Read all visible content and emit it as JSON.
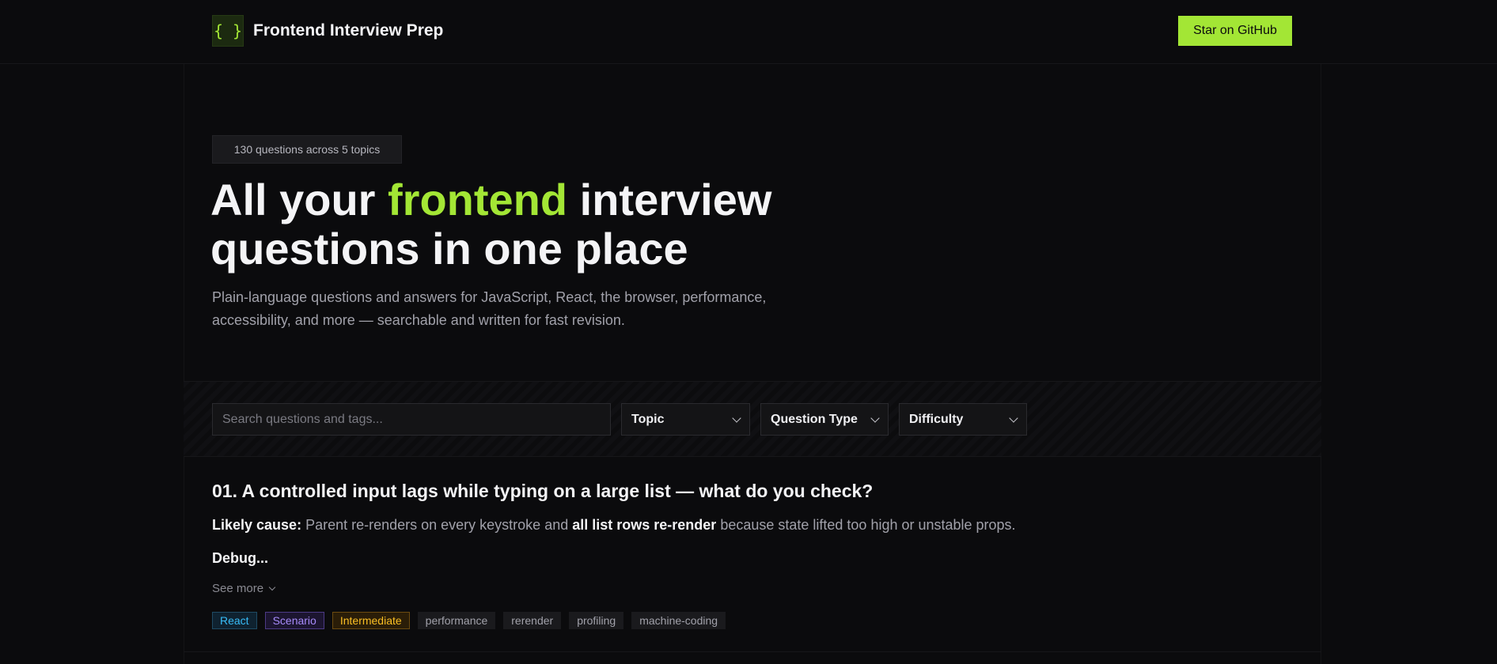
{
  "header": {
    "logo_glyph": "{ }",
    "brand": "Frontend Interview Prep",
    "github_button": "Star on GitHub"
  },
  "hero": {
    "badge": "130 questions across 5 topics",
    "headline_part1": "All your ",
    "headline_accent": "frontend",
    "headline_part2": " interview",
    "headline_line2": "questions in one place",
    "subtitle": "Plain-language questions and answers for JavaScript, React, the browser, performance, accessibility, and more — searchable and written for fast revision."
  },
  "filters": {
    "search_placeholder": "Search questions and tags...",
    "search_value": "",
    "topic": "Topic",
    "question_type": "Question Type",
    "difficulty": "Difficulty"
  },
  "question": {
    "title": "01. A controlled input lags while typing on a large list — what do you check?",
    "likely_label": "Likely cause:",
    "answer_part1": " Parent re-renders on every keystroke and ",
    "answer_bold": "all list rows re-render",
    "answer_part2": " because state lifted too high or unstable props.",
    "debug": "Debug...",
    "see_more": "See more",
    "tags": {
      "topic": "React",
      "type": "Scenario",
      "difficulty": "Intermediate",
      "t1": "performance",
      "t2": "rerender",
      "t3": "profiling",
      "t4": "machine-coding"
    }
  },
  "colors": {
    "accent": "#a3e635",
    "background": "#0b0b0d",
    "react_tag": "#38bdf8",
    "scenario_tag": "#a78bfa",
    "intermediate_tag": "#fbbf24"
  }
}
